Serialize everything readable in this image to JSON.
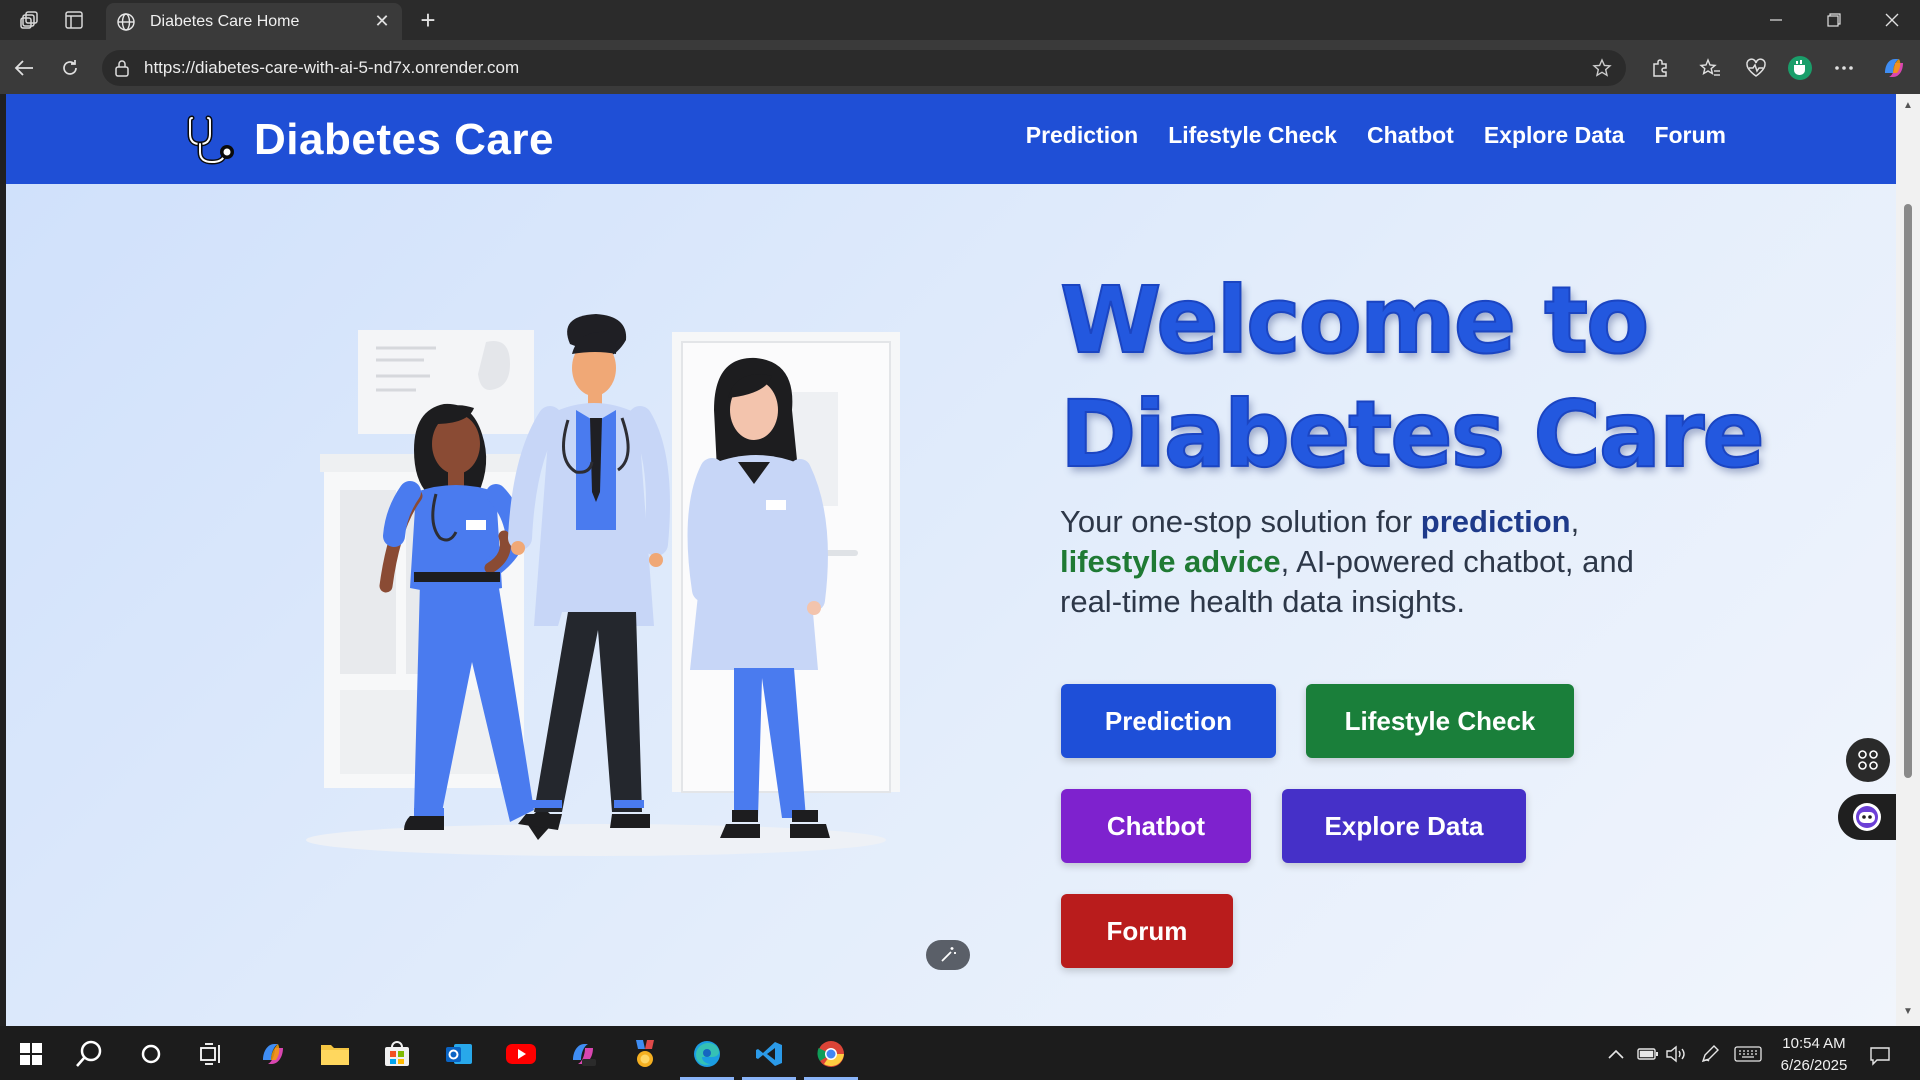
{
  "browser": {
    "tab_title": "Diabetes Care Home",
    "url": "https://diabetes-care-with-ai-5-nd7x.onrender.com"
  },
  "site": {
    "brand": "Diabetes Care",
    "nav": [
      "Prediction",
      "Lifestyle Check",
      "Chatbot",
      "Explore Data",
      "Forum"
    ]
  },
  "hero": {
    "title_line1": "Welcome to",
    "title_line2": "Diabetes Care",
    "subtitle_pre": "Your one-stop solution for ",
    "subtitle_em1": "prediction",
    "subtitle_mid": ", ",
    "subtitle_em2": "lifestyle advice",
    "subtitle_post": ", AI-powered chatbot, and real-time health data insights.",
    "buttons": {
      "prediction": "Prediction",
      "lifestyle": "Lifestyle Check",
      "chatbot": "Chatbot",
      "explore": "Explore Data",
      "forum": "Forum"
    }
  },
  "colors": {
    "header": "#1f4fd6",
    "btn_prediction": "#1e4fd8",
    "btn_lifestyle": "#1a7f3a",
    "btn_chatbot": "#7e22ce",
    "btn_explore": "#4530c8",
    "btn_forum": "#b91c1c"
  },
  "taskbar": {
    "time": "10:54 AM",
    "date": "6/26/2025"
  }
}
